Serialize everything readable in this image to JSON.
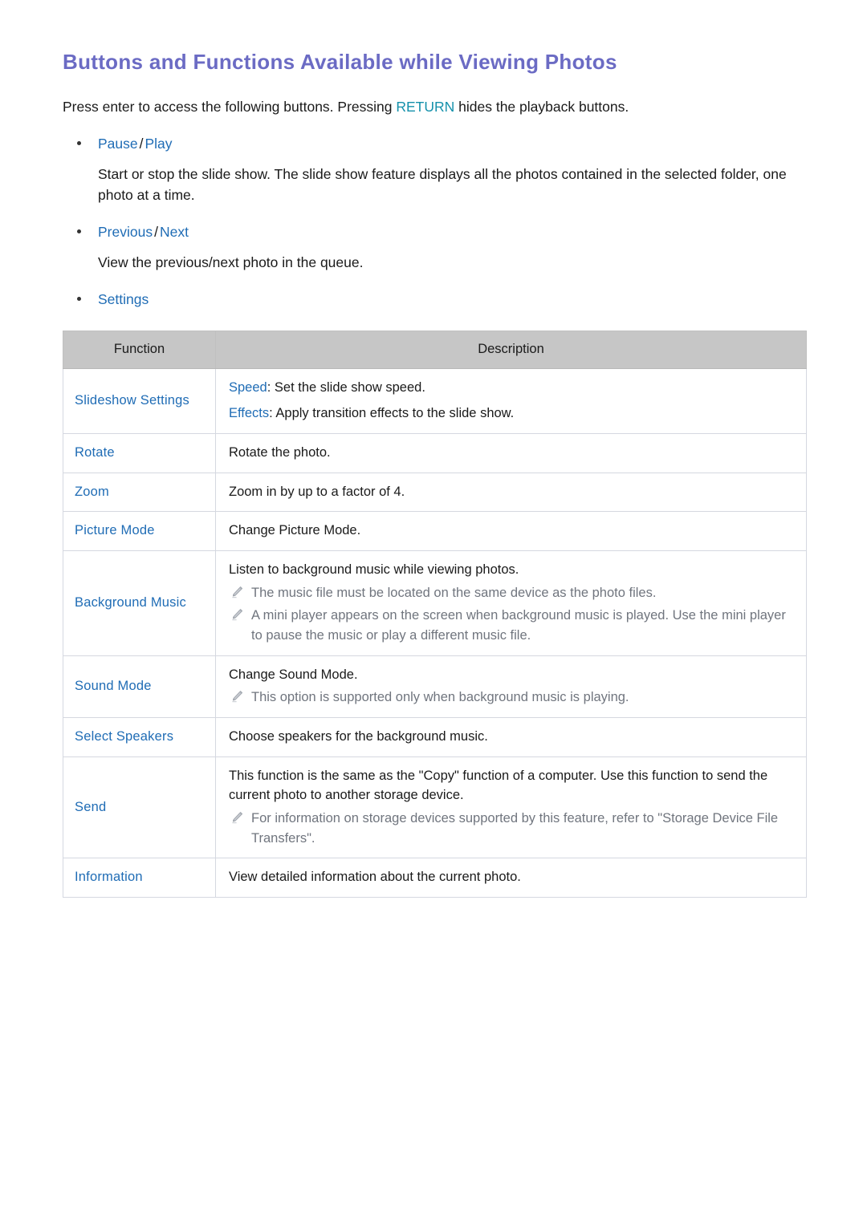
{
  "page": {
    "title": "Buttons and Functions Available while Viewing Photos",
    "intro": {
      "before": "Press enter to access the following buttons. Pressing ",
      "keyword": "RETURN",
      "after": " hides the playback buttons."
    }
  },
  "bullets": [
    {
      "link_a": "Pause",
      "separator": "/",
      "link_b": "Play",
      "description": "Start or stop the slide show. The slide show feature displays all the photos contained in the selected folder, one photo at a time."
    },
    {
      "link_a": "Previous",
      "separator": "/",
      "link_b": "Next",
      "description": "View the previous/next photo in the queue."
    },
    {
      "link_a": "Settings",
      "separator": "",
      "link_b": "",
      "description": ""
    }
  ],
  "table": {
    "headers": {
      "function": "Function",
      "description": "Description"
    },
    "rows": [
      {
        "function": "Slideshow Settings",
        "lines": [
          {
            "keyword": "Speed",
            "text": ": Set the slide show speed."
          },
          {
            "keyword": "Effects",
            "text": ": Apply transition effects to the slide show."
          }
        ],
        "notes": []
      },
      {
        "function": "Rotate",
        "lines": [
          {
            "keyword": "",
            "text": "Rotate the photo."
          }
        ],
        "notes": []
      },
      {
        "function": "Zoom",
        "lines": [
          {
            "keyword": "",
            "text": "Zoom in by up to a factor of 4."
          }
        ],
        "notes": []
      },
      {
        "function": "Picture Mode",
        "lines": [
          {
            "keyword": "",
            "text": "Change Picture Mode."
          }
        ],
        "notes": []
      },
      {
        "function": "Background Music",
        "lines": [
          {
            "keyword": "",
            "text": "Listen to background music while viewing photos."
          }
        ],
        "notes": [
          "The music file must be located on the same device as the photo files.",
          "A mini player appears on the screen when background music is played. Use the mini player to pause the music or play a different music file."
        ]
      },
      {
        "function": "Sound Mode",
        "lines": [
          {
            "keyword": "",
            "text": "Change Sound Mode."
          }
        ],
        "notes": [
          "This option is supported only when background music is playing."
        ]
      },
      {
        "function": "Select Speakers",
        "lines": [
          {
            "keyword": "",
            "text": "Choose speakers for the background music."
          }
        ],
        "notes": []
      },
      {
        "function": "Send",
        "lines": [
          {
            "keyword": "",
            "text": "This function is the same as the \"Copy\" function of a computer. Use this function to send the current photo to another storage device."
          }
        ],
        "notes": [
          "For information on storage devices supported by this feature, refer to \"Storage Device File Transfers\"."
        ]
      },
      {
        "function": "Information",
        "lines": [
          {
            "keyword": "",
            "text": "View detailed information about the current photo."
          }
        ],
        "notes": []
      }
    ]
  },
  "icons": {
    "note": "pencil-icon",
    "bullet": "bullet-dot-icon"
  },
  "colors": {
    "title": "#6b6bc4",
    "link": "#1f6cb5",
    "keyword_return": "#1591ab",
    "note_text": "#70757e",
    "table_header_bg": "#c6c6c6",
    "table_border": "#d5d8e0"
  }
}
